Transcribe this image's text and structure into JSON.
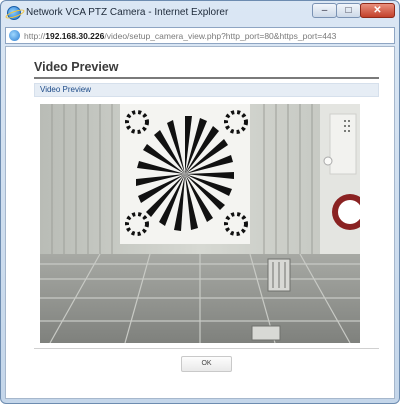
{
  "window": {
    "title": "Network VCA PTZ Camera - Internet Explorer",
    "minimize_glyph": "–",
    "maximize_glyph": "□",
    "close_glyph": "✕"
  },
  "address": {
    "scheme": "http://",
    "host": "192.168.30.226",
    "path": "/video/setup_camera_view.php?http_port=80&https_port=443"
  },
  "page": {
    "heading": "Video Preview",
    "section_label": "Video Preview",
    "ok_label": "OK"
  },
  "icons": {
    "browser": "internet-explorer-icon",
    "address": "internet-explorer-icon"
  },
  "colors": {
    "section_label": "#1c4a88",
    "heading": "#3a3a3a",
    "close_button": "#c2412b"
  }
}
